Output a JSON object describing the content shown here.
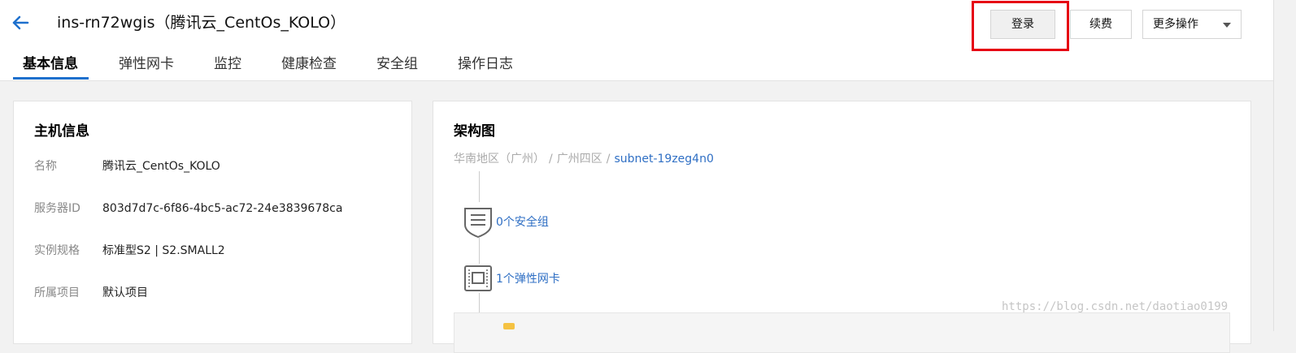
{
  "header": {
    "title": "ins-rn72wgis（腾讯云_CentOs_KOLO）",
    "back_icon": "arrow-left-icon"
  },
  "actions": {
    "login_label": "登录",
    "renew_label": "续费",
    "more_label": "更多操作"
  },
  "tabs": [
    {
      "label": "基本信息",
      "active": true
    },
    {
      "label": "弹性网卡",
      "active": false
    },
    {
      "label": "监控",
      "active": false
    },
    {
      "label": "健康检查",
      "active": false
    },
    {
      "label": "安全组",
      "active": false
    },
    {
      "label": "操作日志",
      "active": false
    }
  ],
  "host_info": {
    "title": "主机信息",
    "rows": [
      {
        "label": "名称",
        "value": "腾讯云_CentOs_KOLO"
      },
      {
        "label": "服务器ID",
        "value": "803d7d7c-6f86-4bc5-ac72-24e3839678ca"
      },
      {
        "label": "实例规格",
        "value": "标准型S2 | S2.SMALL2"
      },
      {
        "label": "所属项目",
        "value": "默认项目"
      }
    ]
  },
  "architecture": {
    "title": "架构图",
    "breadcrumb": {
      "region": "华南地区（广州）",
      "zone": "广州四区",
      "subnet": "subnet-19zeg4n0"
    },
    "nodes": [
      {
        "label": "0个安全组",
        "icon": "shield-icon"
      },
      {
        "label": "1个弹性网卡",
        "icon": "network-card-icon"
      }
    ]
  },
  "watermark": "https://blog.csdn.net/daotiao0199",
  "colors": {
    "accent": "#1e70cd",
    "link": "#2f6fc4",
    "highlight": "#e60012"
  }
}
